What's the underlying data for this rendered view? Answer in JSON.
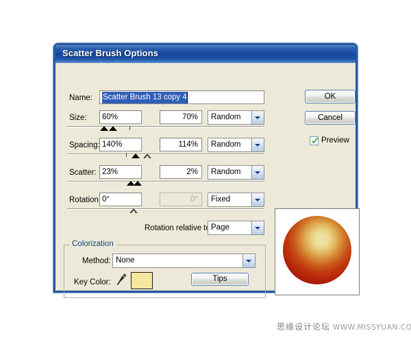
{
  "dialog": {
    "title": "Scatter Brush Options"
  },
  "fields": {
    "name": {
      "label": "Name:",
      "value": "Scatter Brush 13 copy 4"
    },
    "size": {
      "label": "Size:",
      "min_value": "60%",
      "max_value": "70%",
      "mode": "Random"
    },
    "spacing": {
      "label": "Spacing:",
      "min_value": "140%",
      "max_value": "114%",
      "mode": "Random"
    },
    "scatter": {
      "label": "Scatter:",
      "min_value": "23%",
      "max_value": "2%",
      "mode": "Random"
    },
    "rotation": {
      "label": "Rotation:",
      "min_value": "0°",
      "max_value": "0°",
      "mode": "Fixed"
    },
    "rotation_relative": {
      "label": "Rotation relative to:",
      "value": "Page"
    }
  },
  "colorization": {
    "legend": "Colorization",
    "method_label": "Method:",
    "method_value": "None",
    "key_color_label": "Key Color:",
    "key_color_swatch": "#F5E6A0",
    "eyedropper_icon": "eyedropper-icon",
    "tips_label": "Tips"
  },
  "buttons": {
    "ok": "OK",
    "cancel": "Cancel"
  },
  "preview": {
    "label": "Preview",
    "checked": true,
    "check_color": "#2E9E2E"
  },
  "watermark": {
    "cn": "思缘设计论坛",
    "en": "WWW.MISSYUAN.COM"
  },
  "theme": {
    "titlebar_blue": "#15479E",
    "dialog_face": "#ECE9D8",
    "border_blue": "#2C5AA0",
    "selection_blue": "#2F5FB5"
  }
}
